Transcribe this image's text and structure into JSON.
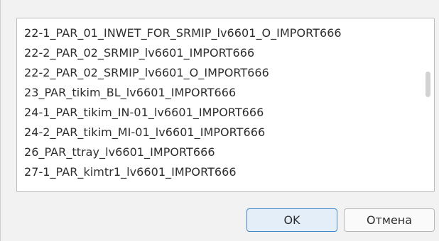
{
  "list": {
    "items": [
      "22-1_PAR_01_INWET_FOR_SRMIP_lv6601_O_IMPORT666",
      "22-2_PAR_02_SRMIP_lv6601_IMPORT666",
      "22-2_PAR_02_SRMIP_lv6601_O_IMPORT666",
      "23_PAR_tikim_BL_lv6601_IMPORT666",
      "24-1_PAR_tikim_IN-01_lv6601_IMPORT666",
      "24-2_PAR_tikim_MI-01_lv6601_IMPORT666",
      "26_PAR_ttray_lv6601_IMPORT666",
      "27-1_PAR_kimtr1_lv6601_IMPORT666"
    ]
  },
  "buttons": {
    "ok_label": "OK",
    "cancel_label": "Отмена"
  },
  "colors": {
    "ok_border": "#3f86c8",
    "ok_background": "#e3eef8"
  }
}
